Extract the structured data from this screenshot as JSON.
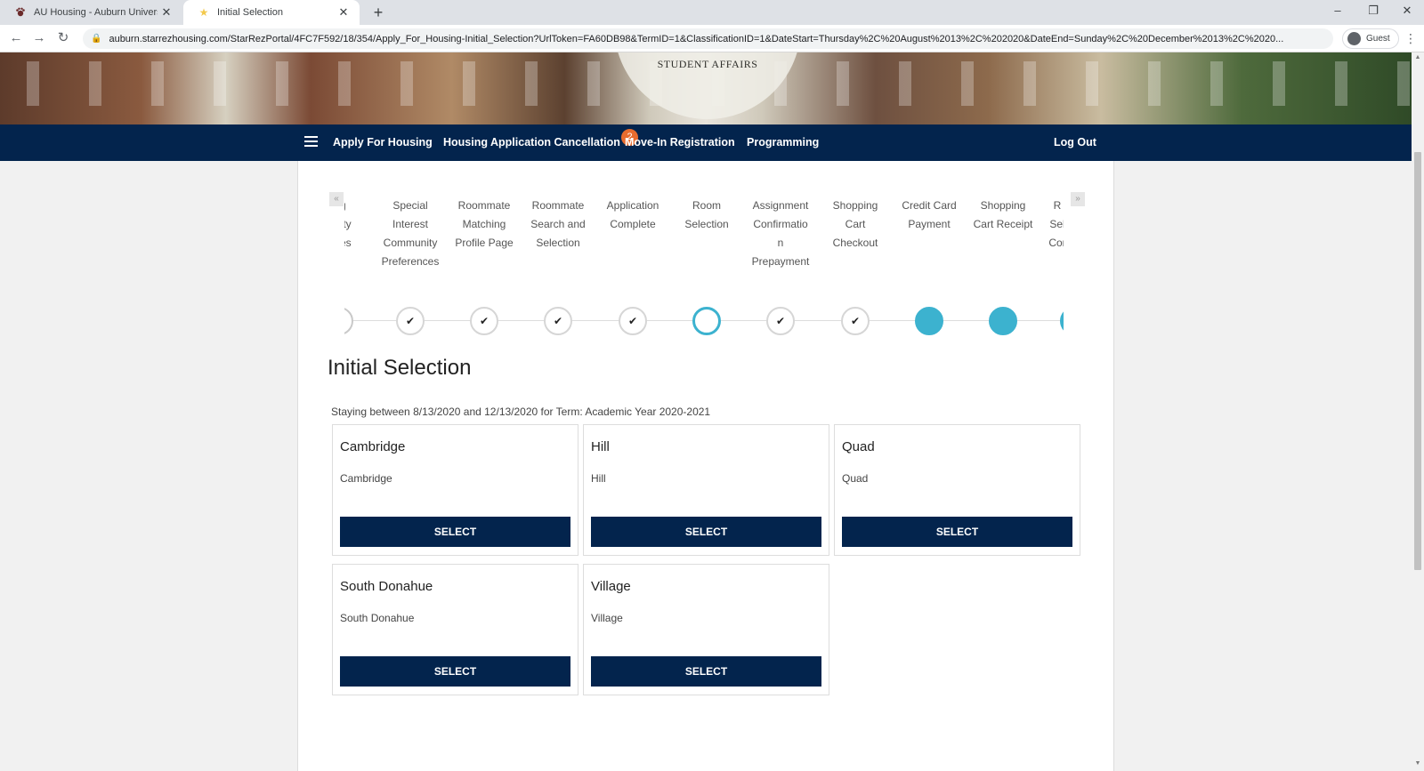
{
  "browser": {
    "tabs": [
      {
        "title": "AU Housing - Auburn University",
        "icon": "auburn-paw-icon"
      },
      {
        "title": "Initial Selection",
        "icon": "star-icon"
      }
    ],
    "url": "auburn.starrezhousing.com/StarRezPortal/4FC7F592/18/354/Apply_For_Housing-Initial_Selection?UrlToken=FA60DB98&TermID=1&ClassificationID=1&DateStart=Thursday%2C%20August%2013%2C%202020&DateEnd=Sunday%2C%20December%2013%2C%2020...",
    "profile_label": "Guest"
  },
  "banner": {
    "seal_text": "STUDENT AFFAIRS"
  },
  "nav": {
    "badge": "2",
    "links": [
      "Apply For Housing",
      "Housing Application Cancellation",
      "Move-In Registration",
      "Programming"
    ],
    "logout": "Log Out"
  },
  "steps": {
    "prev_arrow": "«",
    "next_arrow": "»",
    "labels": [
      "ng\nunity\nnces",
      "Special\nInterest\nCommunity\nPreferences",
      "Roommate\nMatching\nProfile Page",
      "Roommate\nSearch and\nSelection",
      "Application\nComplete",
      "Room\nSelection",
      "Assignment\nConfirmatio\nn\nPrepayment",
      "Shopping\nCart\nCheckout",
      "Credit Card\nPayment",
      "Shopping\nCart Receipt",
      "R\nSel\nCor"
    ],
    "check_glyph": "✔"
  },
  "page": {
    "title": "Initial Selection",
    "stay_text": "Staying between 8/13/2020 and 12/13/2020 for Term: Academic Year 2020-2021"
  },
  "halls": [
    {
      "title": "Cambridge",
      "description": "Cambridge",
      "button": "SELECT"
    },
    {
      "title": "Hill",
      "description": "Hill",
      "button": "SELECT"
    },
    {
      "title": "Quad",
      "description": "Quad",
      "button": "SELECT"
    },
    {
      "title": "South Donahue",
      "description": "South Donahue",
      "button": "SELECT"
    },
    {
      "title": "Village",
      "description": "Village",
      "button": "SELECT"
    }
  ]
}
